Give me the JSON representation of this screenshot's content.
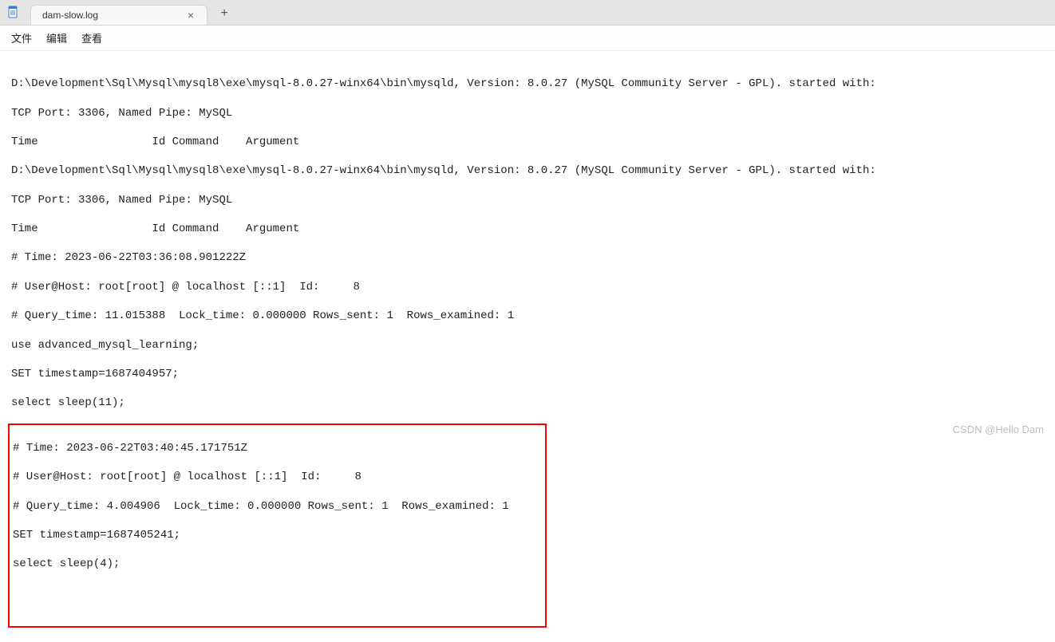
{
  "titlebar": {
    "tab_label": "dam-slow.log",
    "close_glyph": "×",
    "newtab_glyph": "+"
  },
  "menubar": {
    "file": "文件",
    "edit": "编辑",
    "view": "查看"
  },
  "log": {
    "l0": "D:\\Development\\Sql\\Mysql\\mysql8\\exe\\mysql-8.0.27-winx64\\bin\\mysqld, Version: 8.0.27 (MySQL Community Server - GPL). started with:",
    "l1": "TCP Port: 3306, Named Pipe: MySQL",
    "l2": "Time                 Id Command    Argument",
    "l3": "D:\\Development\\Sql\\Mysql\\mysql8\\exe\\mysql-8.0.27-winx64\\bin\\mysqld, Version: 8.0.27 (MySQL Community Server - GPL). started with:",
    "l4": "TCP Port: 3306, Named Pipe: MySQL",
    "l5": "Time                 Id Command    Argument",
    "l6": "# Time: 2023-06-22T03:36:08.901222Z",
    "l7": "# User@Host: root[root] @ localhost [::1]  Id:     8",
    "l8": "# Query_time: 11.015388  Lock_time: 0.000000 Rows_sent: 1  Rows_examined: 1",
    "l9": "use advanced_mysql_learning;",
    "l10": "SET timestamp=1687404957;",
    "l11": "select sleep(11);",
    "h0": "# Time: 2023-06-22T03:40:45.171751Z",
    "h1": "# User@Host: root[root] @ localhost [::1]  Id:     8",
    "h2": "# Query_time: 4.004906  Lock_time: 0.000000 Rows_sent: 1  Rows_examined: 1",
    "h3": "SET timestamp=1687405241;",
    "h4": "select sleep(4);"
  },
  "watermark": "CSDN @Hello Dam"
}
